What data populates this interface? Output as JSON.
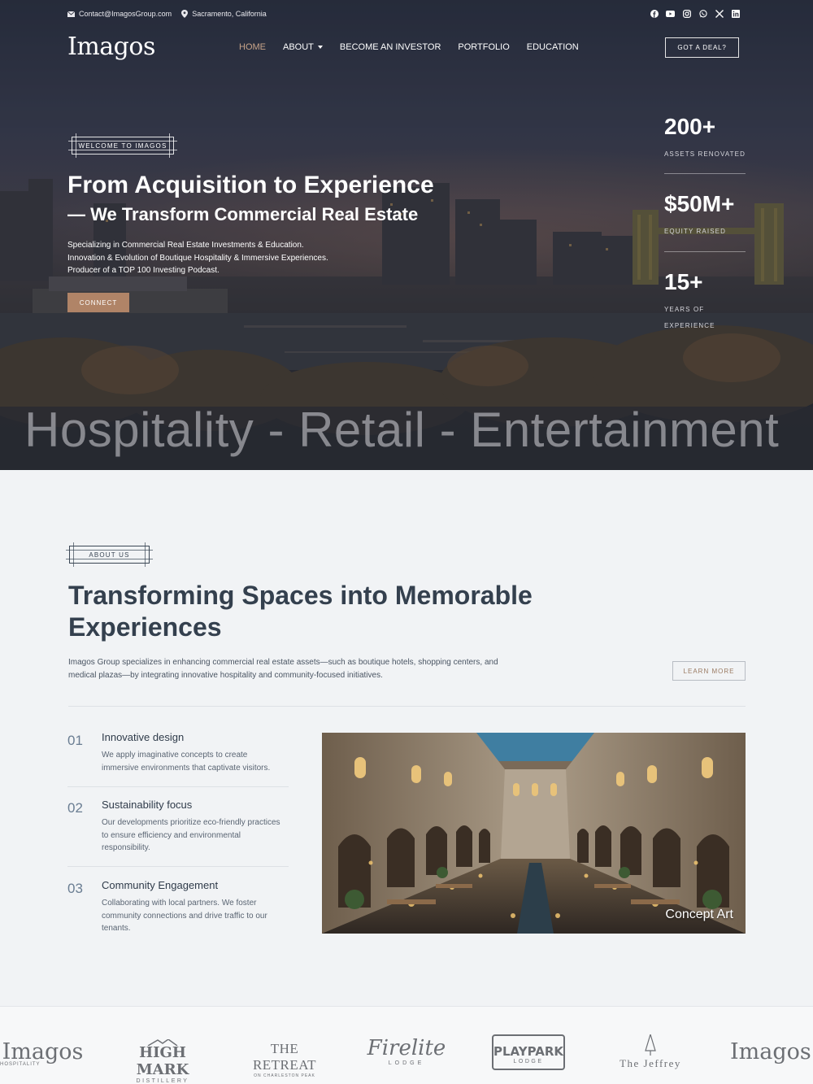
{
  "topbar": {
    "email": "Contact@ImagosGroup.com",
    "location": "Sacramento, California",
    "socials": [
      "facebook-icon",
      "youtube-icon",
      "instagram-icon",
      "whatsapp-icon",
      "x-icon",
      "linkedin-icon"
    ]
  },
  "header": {
    "logo": "Imagos",
    "nav": [
      "HOME",
      "ABOUT",
      "BECOME AN INVESTOR",
      "PORTFOLIO",
      "EDUCATION"
    ],
    "active_nav": "HOME",
    "cta": "GOT A DEAL?"
  },
  "hero": {
    "tag": "WELCOME TO IMAGOS",
    "title": "From Acquisition to Experience",
    "subtitle": "— We Transform Commercial Real Estate",
    "lines": [
      "Specializing in Commercial Real Estate Investments & Education.",
      "Innovation & Evolution of Boutique Hospitality & Immersive Experiences.",
      "Producer of a TOP 100 Investing Podcast."
    ],
    "button": "CONNECT",
    "stats": [
      {
        "value": "200+",
        "label_lines": [
          "ASSETS RENOVATED"
        ]
      },
      {
        "value": "$50M+",
        "label_lines": [
          "EQUITY RAISED"
        ]
      },
      {
        "value": "15+",
        "label_lines": [
          "YEARS OF",
          "EXPERIENCE"
        ]
      }
    ],
    "marquee": "Hospitality - Retail - Entertainment"
  },
  "about": {
    "tag": "ABOUT US",
    "heading_lines": [
      "Transforming Spaces into Memorable",
      "Experiences"
    ],
    "paragraph_lines": [
      "Imagos Group specializes in enhancing commercial real estate assets—such as boutique hotels, shopping centers, and",
      "medical plazas—by integrating innovative hospitality and community-focused initiatives."
    ],
    "button": "LEARN MORE",
    "features": [
      {
        "num": "01",
        "title": "Innovative design",
        "desc_lines": [
          "We apply imaginative concepts to create",
          "immersive environments that captivate visitors."
        ]
      },
      {
        "num": "02",
        "title": "Sustainability focus",
        "desc_lines": [
          "Our developments prioritize eco-friendly practices",
          "to ensure efficiency and environmental",
          "responsibility."
        ]
      },
      {
        "num": "03",
        "title": "Community Engagement",
        "desc_lines": [
          "Collaborating with local partners. We foster",
          "community connections and drive traffic to our",
          "tenants."
        ]
      }
    ],
    "image_caption": "Concept Art"
  },
  "brands": [
    {
      "name": "Imagos",
      "sub": "HOSPITALITY"
    },
    {
      "name": "HIGH MARK",
      "sub": "DISTILLERY"
    },
    {
      "name": "THE RETREAT",
      "sub": "ON CHARLESTON PEAK"
    },
    {
      "name": "Firelite",
      "sub": "LODGE"
    },
    {
      "name": "PLAYPARK",
      "sub": "LODGE"
    },
    {
      "name": "The Jeffrey",
      "sub": ""
    },
    {
      "name": "Imagos",
      "sub": ""
    }
  ],
  "colors": {
    "accent": "#b08467",
    "dark_text": "#34404e",
    "background": "#f1f3f5"
  }
}
